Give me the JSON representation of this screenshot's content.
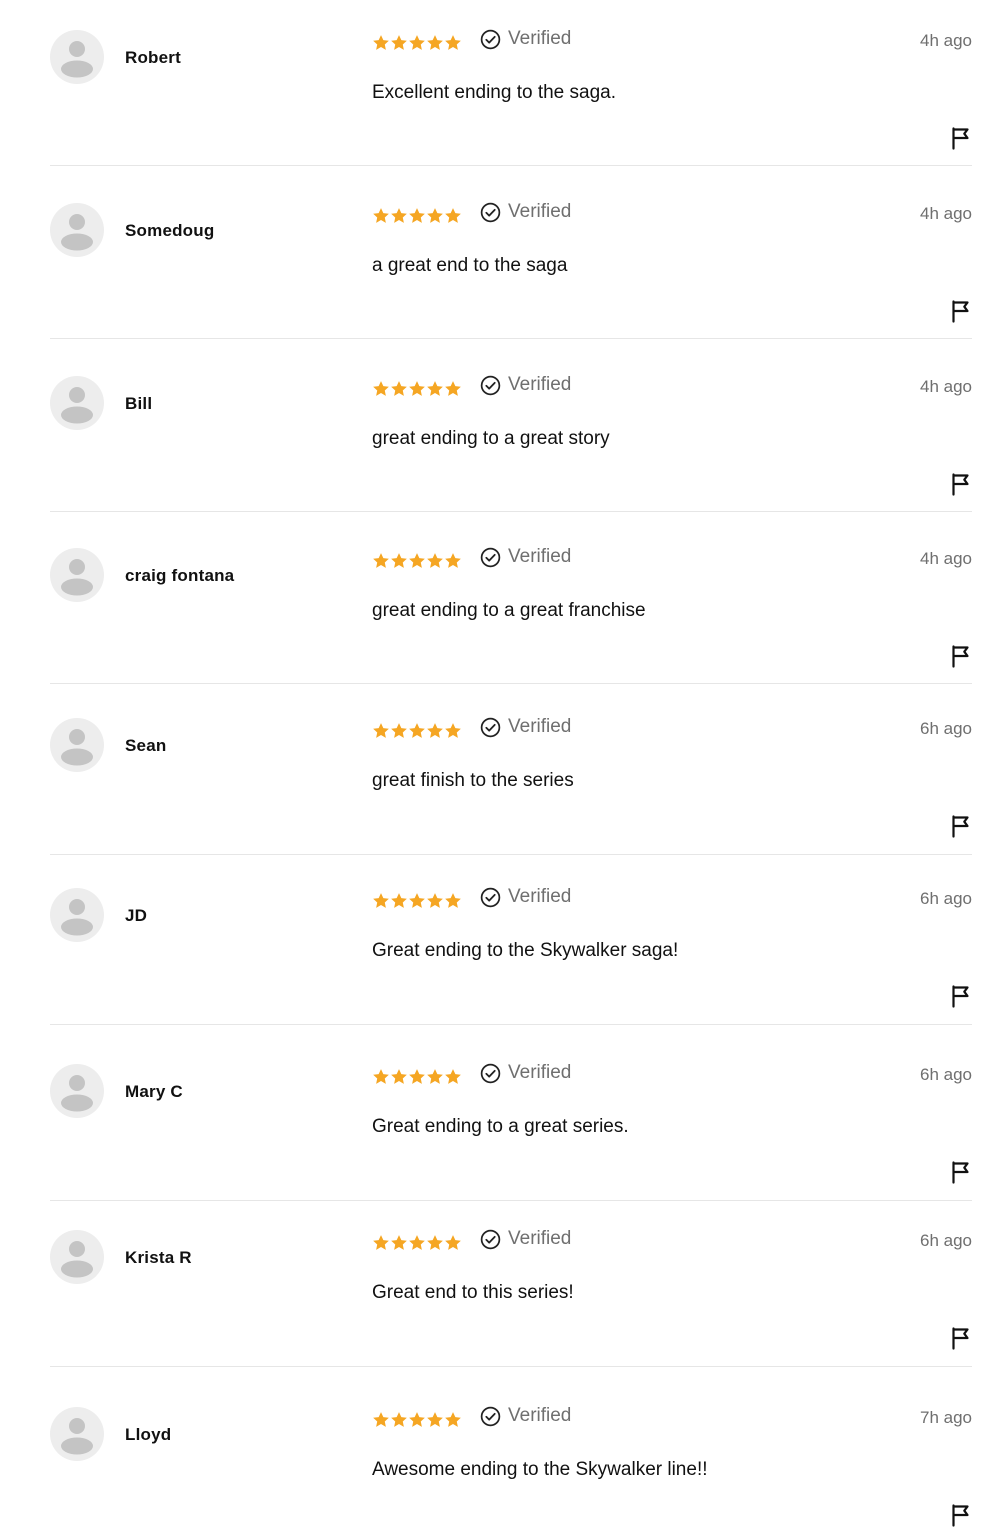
{
  "colors": {
    "star": "#F5A623",
    "muted": "#6f6f6f",
    "text": "#111111",
    "avatar_bg": "#ededed",
    "avatar_fg": "#c4c4c4",
    "divider": "#e6e6e6"
  },
  "icons": {
    "avatar": "user-silhouette-icon",
    "star": "star-icon",
    "verified": "check-circle-icon",
    "flag": "flag-icon"
  },
  "reviews": [
    {
      "user": "Robert",
      "rating": 5,
      "verified_label": "Verified",
      "time": "4h ago",
      "text": "Excellent ending to the saga."
    },
    {
      "user": "Somedoug",
      "rating": 5,
      "verified_label": "Verified",
      "time": "4h ago",
      "text": "a great end to the saga"
    },
    {
      "user": "Bill",
      "rating": 5,
      "verified_label": "Verified",
      "time": "4h ago",
      "text": "great ending to a great story"
    },
    {
      "user": "craig fontana",
      "rating": 5,
      "verified_label": "Verified",
      "time": "4h ago",
      "text": "great ending to a great franchise"
    },
    {
      "user": "Sean",
      "rating": 5,
      "verified_label": "Verified",
      "time": "6h ago",
      "text": "great finish to the series"
    },
    {
      "user": "JD",
      "rating": 5,
      "verified_label": "Verified",
      "time": "6h ago",
      "text": "Great ending to the Skywalker saga!"
    },
    {
      "user": "Mary C",
      "rating": 5,
      "verified_label": "Verified",
      "time": "6h ago",
      "text": "Great ending to a great series."
    },
    {
      "user": "Krista R",
      "rating": 5,
      "verified_label": "Verified",
      "time": "6h ago",
      "text": "Great end to this series!"
    },
    {
      "user": "Lloyd",
      "rating": 5,
      "verified_label": "Verified",
      "time": "7h ago",
      "text": "Awesome ending to the Skywalker line!!"
    }
  ]
}
